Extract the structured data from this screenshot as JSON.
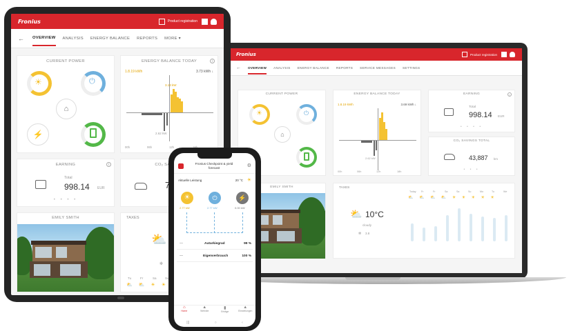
{
  "tablet": {
    "logo": "Fronius",
    "header": {
      "product_registration": "Product registration"
    },
    "tabs": [
      "OVERVIEW",
      "ANALYSIS",
      "ENERGY BALANCE",
      "REPORTS",
      "MORE ▾"
    ],
    "current_power": {
      "title": "CURRENT POWER"
    },
    "energy_balance": {
      "title": "ENERGY BALANCE TODAY",
      "left_value": "1.8.19 kWh",
      "right_value": "3.73 kWh ↓",
      "peak_label": "3.13 kW",
      "low_label": "2.62 kW",
      "x_ticks": [
        "00h",
        "06h",
        "12h",
        "18h"
      ]
    },
    "earning": {
      "title": "EARNING",
      "label": "Total",
      "value": "998.14",
      "unit": "EUR"
    },
    "co2": {
      "title": "CO₂ SAVINGS",
      "value": "7"
    },
    "emily": {
      "title": "EMILY SMITH"
    },
    "taxes": {
      "title": "TAXES",
      "days": [
        "Tu",
        "Fr",
        "Sa",
        "Su"
      ]
    }
  },
  "laptop": {
    "logo": "Fronius",
    "header": {
      "product_registration": "Product registration"
    },
    "tabs": [
      "OVERVIEW",
      "ANALYSIS",
      "ENERGY BALANCE",
      "REPORTS",
      "SERVICE MESSAGES",
      "SETTINGS"
    ],
    "current_power": {
      "title": "CURRENT POWER"
    },
    "energy_balance": {
      "title": "ENERGY BALANCE TODAY",
      "left_value": "1.8.19 kWh",
      "right_value": "3.69 kWh ↓",
      "low_label": "2.62 kW",
      "x_ticks": [
        "00h",
        "06h",
        "12h",
        "18h"
      ]
    },
    "earning": {
      "title": "EARNING",
      "label": "Total",
      "value": "998.14",
      "unit": "EUR"
    },
    "co2": {
      "title": "CO₂ SAVINGS TOTAL",
      "value": "43,887",
      "unit": "km"
    },
    "emily": {
      "title": "EMILY SMITH"
    },
    "taxes": {
      "title": "TAXES",
      "current_temp": "10°C",
      "condition": "cloudy",
      "wind": "3.8",
      "days": [
        "Today",
        "Fr",
        "Fr",
        "Sa",
        "Sa",
        "Su",
        "Mo",
        "Tu",
        "We"
      ]
    }
  },
  "phone": {
    "title_line1": "Fronius Checkpoint & yield",
    "title_line2": "forecast",
    "current_label": "Aktuelle Leistung",
    "current_value": "20 °C",
    "kpi_values": [
      "2.77 kW",
      "2.77 kW",
      "0.00 kW"
    ],
    "rows": [
      {
        "label": "Autarkiegrad",
        "value": "99 %"
      },
      {
        "label": "Eigenverbrauch",
        "value": "100 %"
      }
    ],
    "bottom_nav": [
      "Home",
      "Website",
      "Erträge",
      "Einstellungen"
    ]
  },
  "colors": {
    "brand": "#d8262c",
    "solar": "#f4c232",
    "grid": "#6fb0dd",
    "battery": "#53b848"
  }
}
